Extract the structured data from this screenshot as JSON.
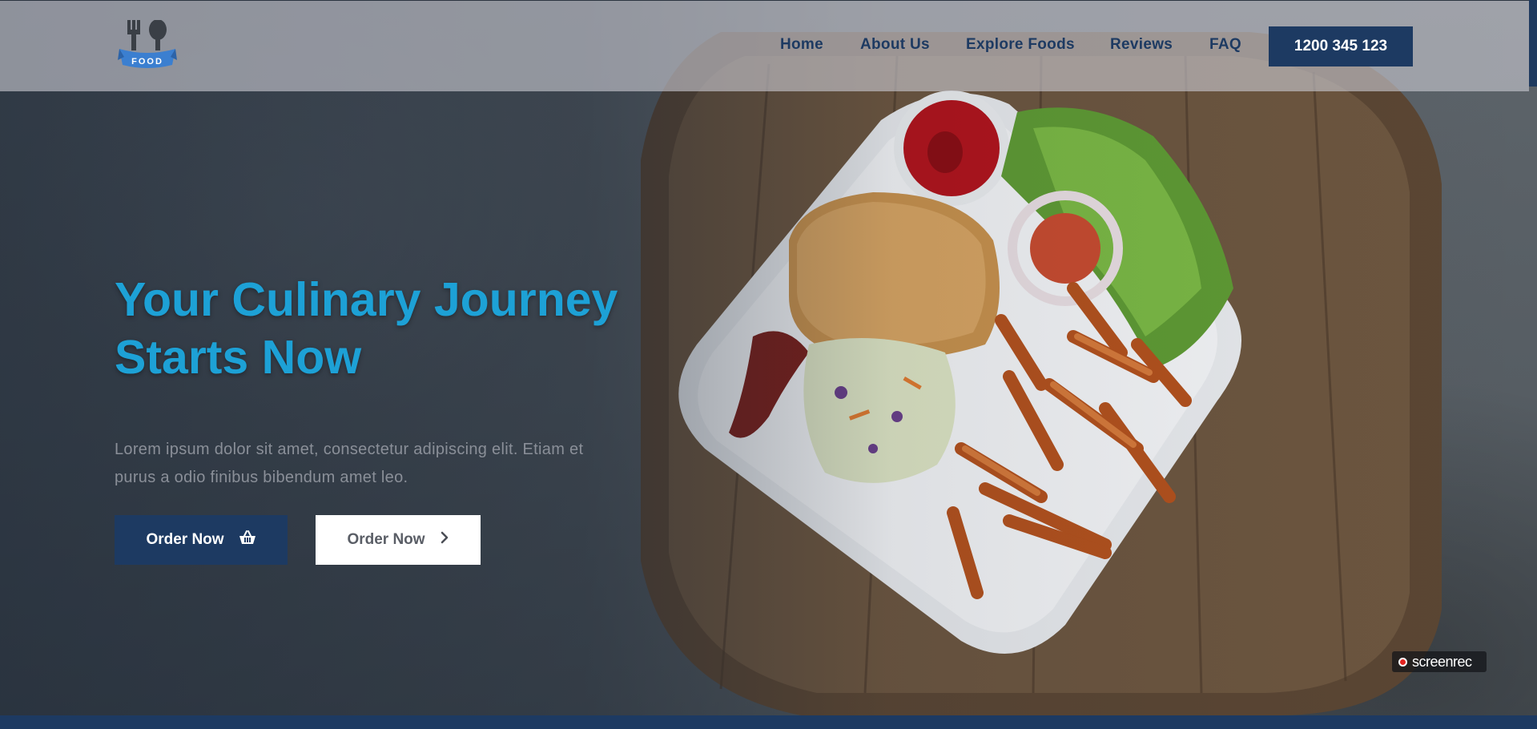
{
  "header": {
    "logo_text": "FOOD",
    "nav": [
      {
        "label": "Home"
      },
      {
        "label": "About Us"
      },
      {
        "label": "Explore Foods"
      },
      {
        "label": "Reviews"
      },
      {
        "label": "FAQ"
      }
    ],
    "phone_button": "1200 345 123"
  },
  "hero": {
    "title_line1": "Your Culinary Journey",
    "title_line2": "Starts Now",
    "description_line1": "Lorem ipsum dolor sit amet, consectetur adipiscing elit. Etiam et",
    "description_line2": "purus a odio finibus bibendum amet leo.",
    "primary_button": "Order Now",
    "secondary_button": "Order Now"
  },
  "recorder_badge": {
    "label": "screenrec"
  },
  "colors": {
    "brand_navy": "#1d3a62",
    "title_blue": "#1da1d6",
    "logo_blue": "#3b7fd0"
  },
  "icons": {
    "logo": "fork-spoon-icon",
    "primary_button": "basket-icon",
    "secondary_button": "chevron-right-icon",
    "recorder": "record-dot-icon"
  }
}
